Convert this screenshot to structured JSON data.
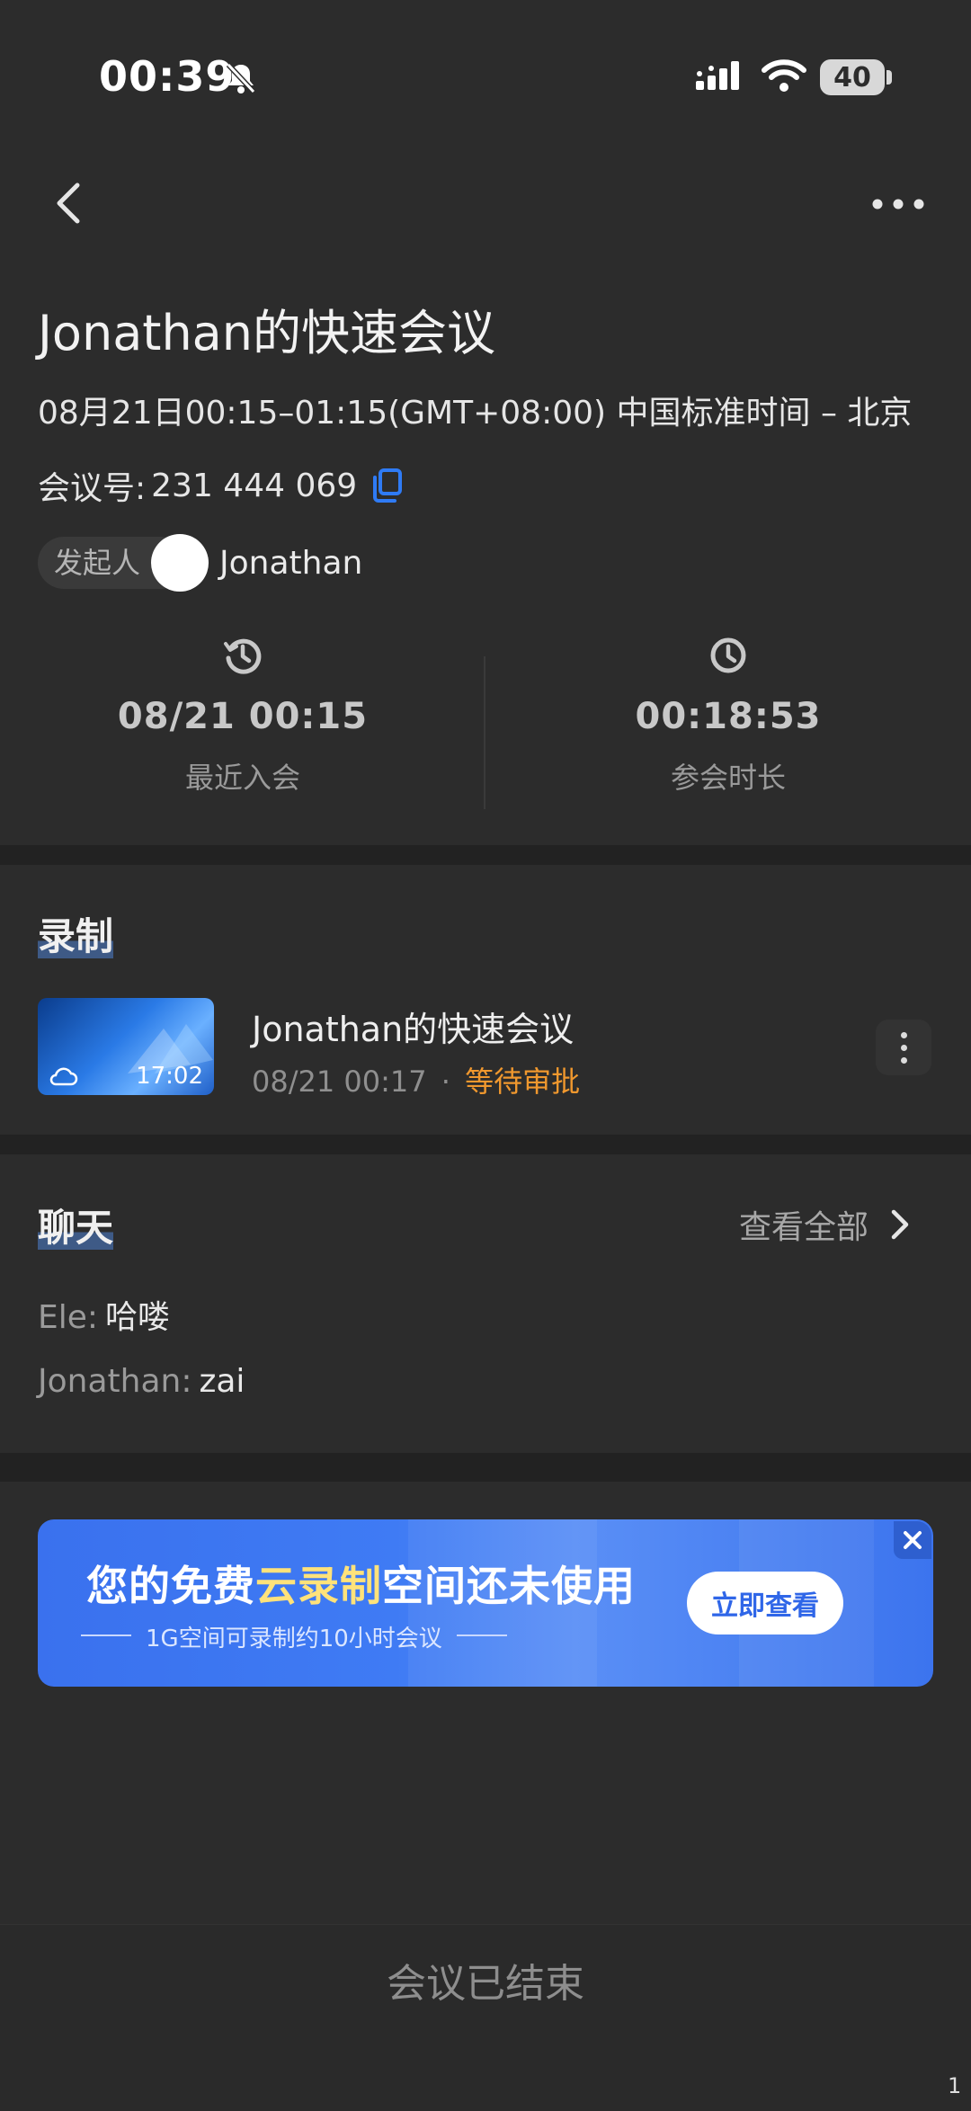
{
  "status_bar": {
    "time": "00:39",
    "battery": "40"
  },
  "meeting": {
    "title": "Jonathan的快速会议",
    "time_range": "08月21日00:15–01:15(GMT+08:00) 中国标准时间 – 北京",
    "id_label": "会议号:",
    "id_value": "231 444 069",
    "host_tag": "发起人",
    "host_name": "Jonathan"
  },
  "stats": [
    {
      "value": "08/21 00:15",
      "label": "最近入会",
      "icon": "history-icon"
    },
    {
      "value": "00:18:53",
      "label": "参会时长",
      "icon": "clock-icon"
    }
  ],
  "recording": {
    "section_title": "录制",
    "item": {
      "thumb_duration": "17:02",
      "title": "Jonathan的快速会议",
      "date": "08/21 00:17",
      "separator": "·",
      "status": "等待审批"
    }
  },
  "chat": {
    "section_title": "聊天",
    "see_all": "查看全部",
    "messages": [
      {
        "sender": "Ele:",
        "text": "哈喽"
      },
      {
        "sender": "Jonathan:",
        "text": "zai"
      }
    ]
  },
  "banner": {
    "main_a": "您的免费",
    "main_highlight": "云录制",
    "main_b": "空间还未使用",
    "sub": "1G空间可录制约10小时会议",
    "button": "立即查看"
  },
  "footer": {
    "text": "会议已结束",
    "corner_mark": "1"
  },
  "colors": {
    "background": "#2c2c2c",
    "accent_blue": "#2f7bf5",
    "pending_orange": "#f0982e"
  }
}
